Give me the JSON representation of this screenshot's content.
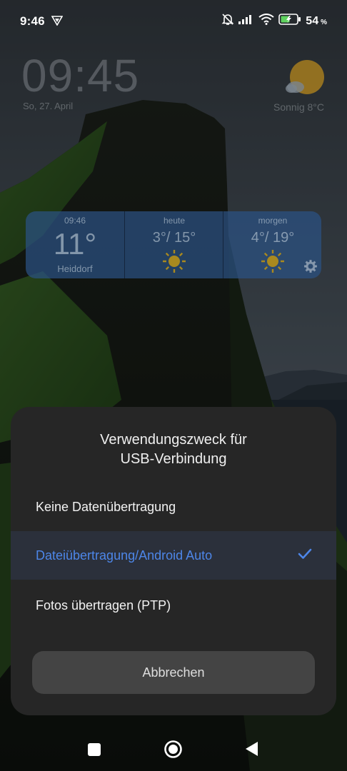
{
  "status_bar": {
    "time": "9:46",
    "battery_level": "54",
    "battery_unit": "%",
    "icons": [
      "vpn-icon",
      "mute-icon",
      "signal-icon",
      "wifi-icon",
      "battery-charging-icon"
    ]
  },
  "lockscreen": {
    "clock": "09:45",
    "date": "So, 27. April",
    "weather_text": "Sonnig  8°C"
  },
  "weather_widget": {
    "current": {
      "time": "09:46",
      "temp": "11°",
      "location": "Heiddorf"
    },
    "today": {
      "label": "heute",
      "range": "3°/ 15°"
    },
    "tomorrow": {
      "label": "morgen",
      "range": "4°/ 19°"
    }
  },
  "dialog": {
    "title_line1": "Verwendungszweck für",
    "title_line2": "USB-Verbindung",
    "options": [
      {
        "label": "Keine Datenübertragung",
        "selected": false
      },
      {
        "label": "Dateiübertragung/Android Auto",
        "selected": true
      },
      {
        "label": "Fotos übertragen (PTP)",
        "selected": false
      }
    ],
    "cancel_label": "Abbrechen"
  },
  "colors": {
    "accent": "#4d86e8",
    "dialog_bg": "#262626",
    "selected_row_bg": "#2b303b",
    "cancel_bg": "#444444"
  },
  "nav_bar": {
    "icons": [
      "recents-icon",
      "home-icon",
      "back-icon"
    ]
  }
}
